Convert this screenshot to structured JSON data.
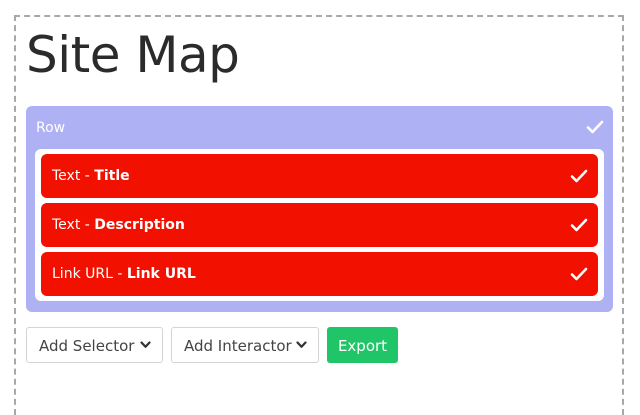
{
  "page": {
    "title": "Site Map"
  },
  "row": {
    "label": "Row",
    "check_icon": "check-icon",
    "items": [
      {
        "type": "Text",
        "separator": " - ",
        "name": "Title"
      },
      {
        "type": "Text",
        "separator": " - ",
        "name": "Description"
      },
      {
        "type": "Link URL",
        "separator": " - ",
        "name": "Link URL"
      }
    ]
  },
  "toolbar": {
    "add_selector_label": "Add Selector",
    "add_interactor_label": "Add Interactor",
    "export_label": "Export",
    "dropdown_icon": "chevron-down-icon"
  },
  "colors": {
    "row_background": "#aeb2f5",
    "item_background": "#f21101",
    "export_background": "#20c567",
    "title_text": "#2b2b2b"
  }
}
